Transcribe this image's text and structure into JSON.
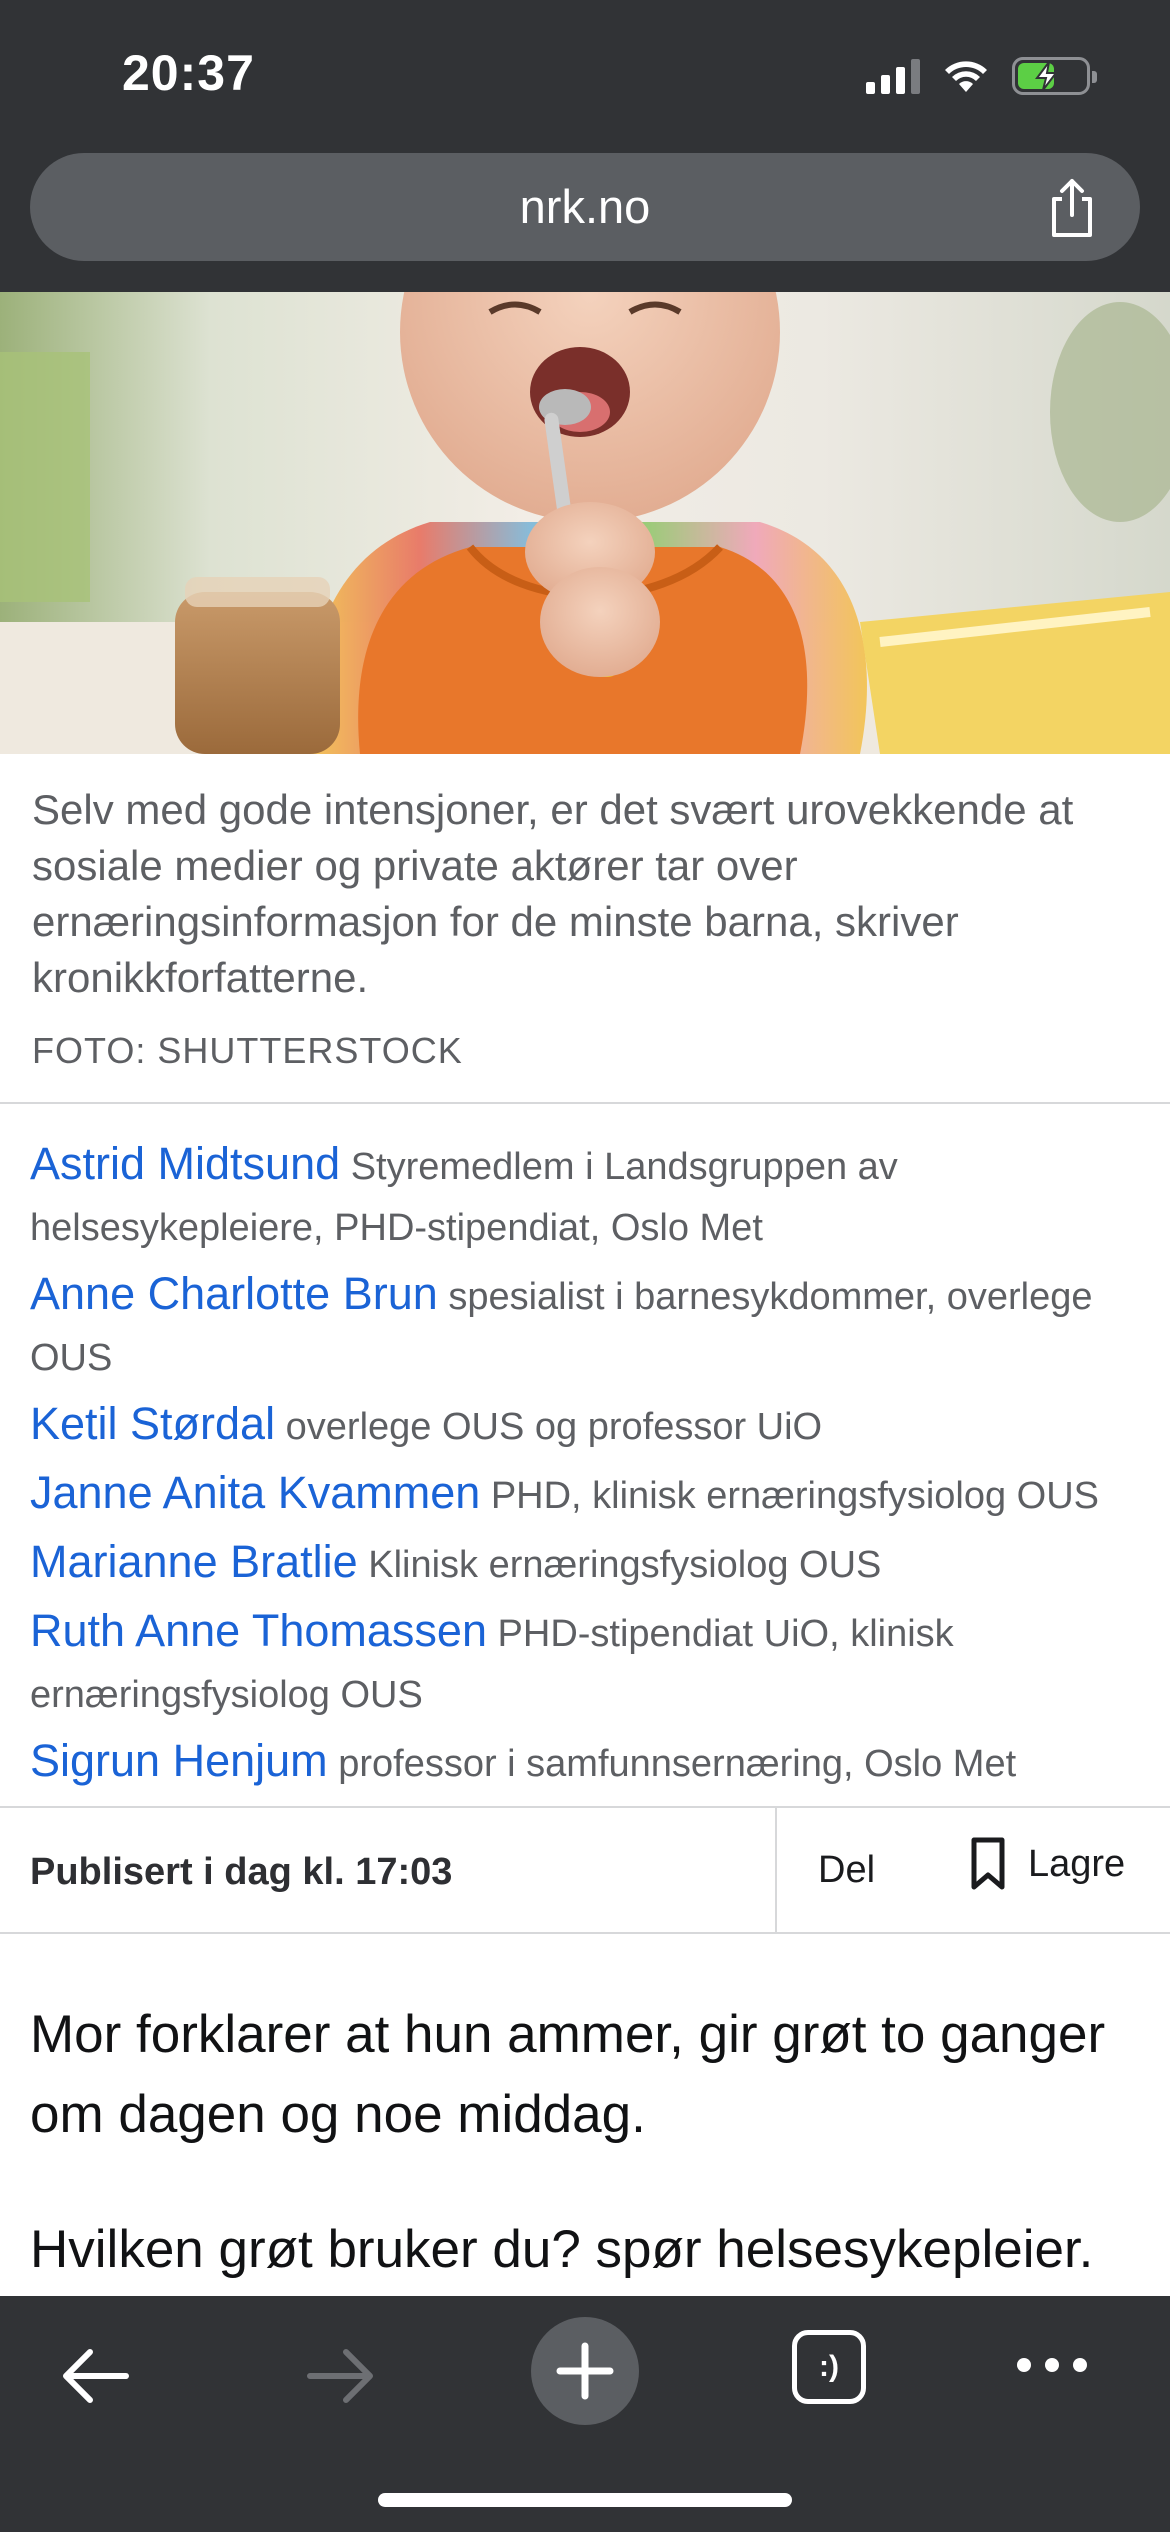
{
  "status_bar": {
    "time": "20:37"
  },
  "browser": {
    "url": "nrk.no"
  },
  "hero": {
    "caption": "Selv med gode intensjoner, er det svært urovekkende at sosiale medier og private aktører tar over ernæringsinformasjon for de minste barna, skriver kronikkforfatterne.",
    "credit": "FOTO: SHUTTERSTOCK"
  },
  "authors": [
    {
      "name": "Astrid Midtsund",
      "role": "Styremedlem i Landsgruppen av helsesykepleiere, PHD-stipendiat, Oslo Met"
    },
    {
      "name": "Anne Charlotte Brun",
      "role": "spesialist i barnesykdommer, overlege OUS"
    },
    {
      "name": "Ketil Størdal",
      "role": "overlege OUS og professor UiO"
    },
    {
      "name": "Janne Anita Kvammen",
      "role": "PHD, klinisk ernæringsfysiolog OUS"
    },
    {
      "name": "Marianne Bratlie",
      "role": "Klinisk ernæringsfysiolog OUS"
    },
    {
      "name": "Ruth Anne Thomassen",
      "role": "PHD-stipendiat UiO, klinisk ernæringsfysiolog OUS"
    },
    {
      "name": "Sigrun Henjum",
      "role": "professor i samfunnsernæring, Oslo Met"
    }
  ],
  "publish": {
    "date": "Publisert i dag kl. 17:03",
    "share_label": "Del",
    "save_label": "Lagre"
  },
  "article": {
    "paragraphs": [
      "Mor forklarer at hun ammer, gir grøt to ganger om dagen og noe middag.",
      "Hvilken grøt bruker du? spør helsesykepleier."
    ]
  },
  "toolbar": {
    "tabs_label": ":)"
  },
  "colors": {
    "chrome": "#313336",
    "link": "#1a63d6",
    "text_muted": "#5d5f63"
  }
}
